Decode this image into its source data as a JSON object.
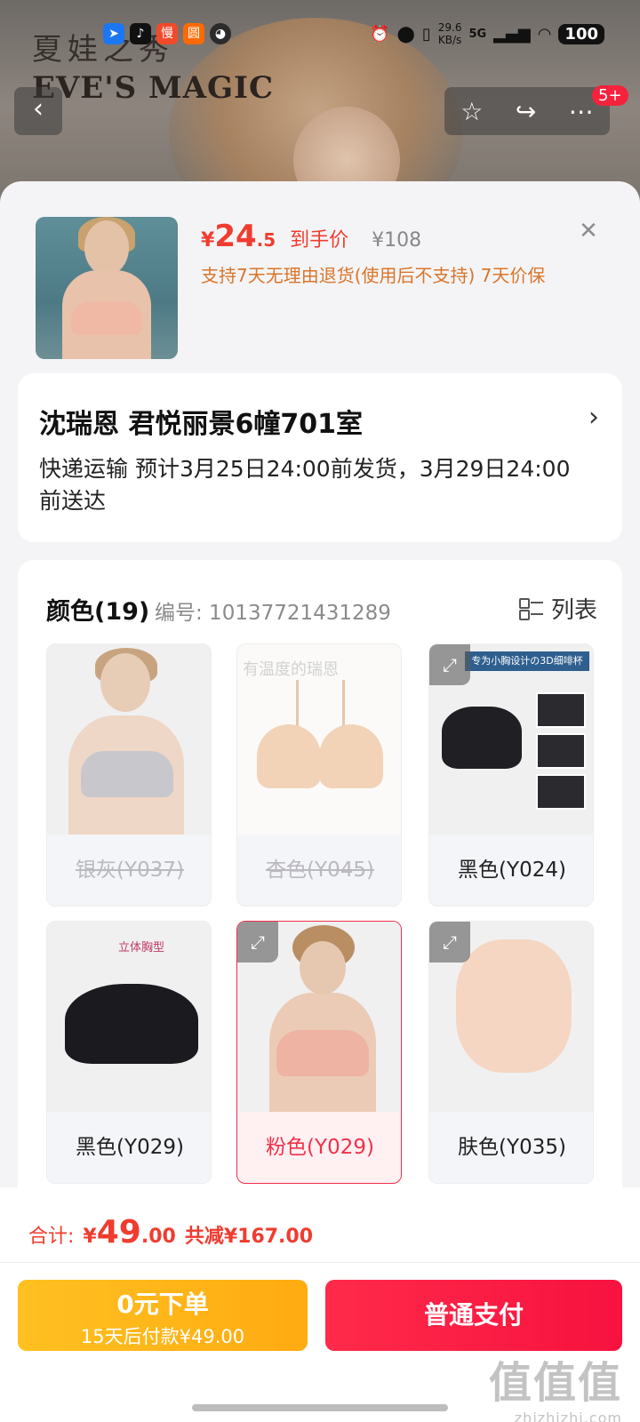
{
  "status": {
    "time": "",
    "speed_value": "29.6",
    "speed_unit": "KB/s",
    "network": "5G",
    "battery": "100"
  },
  "brand": {
    "cn": "夏娃之秀",
    "en": "EVE'S MAGIC"
  },
  "nav": {
    "badge": "5+"
  },
  "product": {
    "currency": "¥",
    "price_int": "24",
    "price_dec": ".5",
    "price_tag": "到手价",
    "original_price": "¥108",
    "policy": "支持7天无理由退货(使用后不支持)  7天价保"
  },
  "address": {
    "name_line": "沈瑞恩  君悦丽景6幢701室",
    "shipping": "快递运输 预计3月25日24:00前发货，3月29日24:00前送达"
  },
  "options": {
    "title": "颜色(19)",
    "code_label": "编号: 10137721431289",
    "list_toggle": "列表",
    "items": [
      {
        "label": "银灰(Y037)",
        "state": "disabled"
      },
      {
        "label": "杏色(Y045)",
        "state": "disabled",
        "overlay": "有温度的瑞恩"
      },
      {
        "label": "黑色(Y024)",
        "state": "normal",
        "ad_title": "专为小胸设计の3D细啡杯"
      },
      {
        "label": "黑色(Y029)",
        "state": "normal",
        "ad_text": "立体胸型"
      },
      {
        "label": "粉色(Y029)",
        "state": "selected"
      },
      {
        "label": "肤色(Y035)",
        "state": "normal"
      }
    ]
  },
  "footer": {
    "total_label": "合计:",
    "currency": "¥",
    "total_int": "49",
    "total_dec": ".00",
    "saved": "共减¥167.00",
    "later_title": "0元下单",
    "later_sub": "15天后付款¥49.00",
    "pay_label": "普通支付"
  },
  "watermark": {
    "big": "值值值",
    "small": "zhizhizhi.com"
  },
  "colors": {
    "accent": "#f03c2f",
    "pay": "#f7123f",
    "later": "#ffb518",
    "selected_border": "#f0314a"
  }
}
